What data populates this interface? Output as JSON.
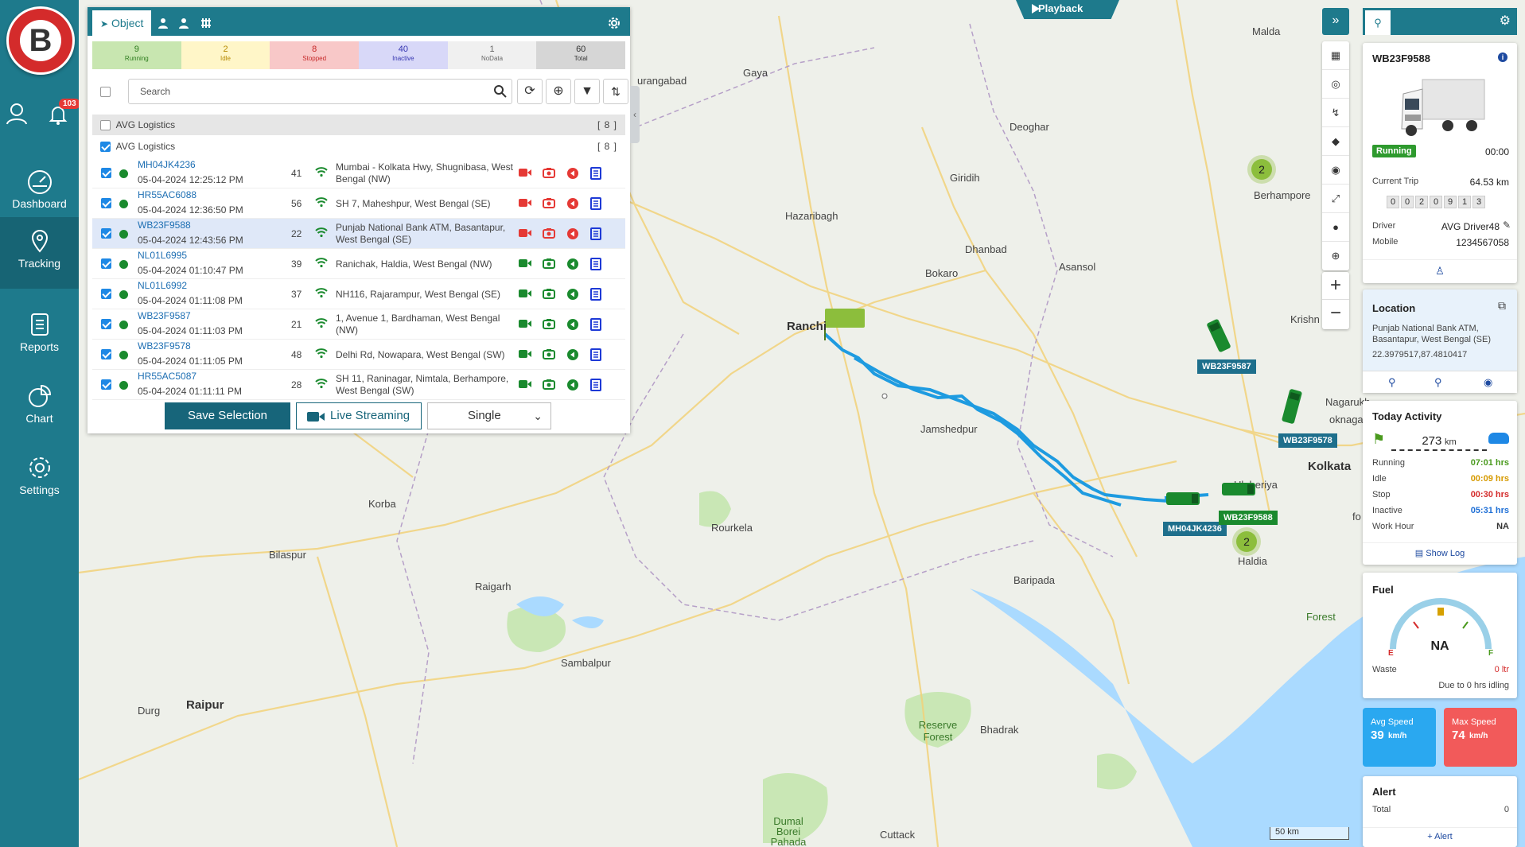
{
  "sidebar": {
    "notification_count": "103",
    "items": [
      {
        "label": "Dashboard"
      },
      {
        "label": "Tracking"
      },
      {
        "label": "Reports"
      },
      {
        "label": "Chart"
      },
      {
        "label": "Settings"
      }
    ]
  },
  "panel": {
    "tab_object": "Object",
    "stats": [
      {
        "value": "9",
        "label": "Running",
        "bg": "#c8e6b0",
        "color": "#2e7d1e"
      },
      {
        "value": "2",
        "label": "Idle",
        "bg": "#fff6c8",
        "color": "#b58900"
      },
      {
        "value": "8",
        "label": "Stopped",
        "bg": "#f8c8c8",
        "color": "#c62828"
      },
      {
        "value": "40",
        "label": "Inactive",
        "bg": "#d8d8f8",
        "color": "#3535b0"
      },
      {
        "value": "1",
        "label": "NoData",
        "bg": "#f0f0f0",
        "color": "#666"
      },
      {
        "value": "60",
        "label": "Total",
        "bg": "#d6d6d6",
        "color": "#333"
      }
    ],
    "search_placeholder": "Search",
    "groups": [
      {
        "name": "AVG Logistics",
        "count": "[ 8 ]"
      },
      {
        "name": "AVG Logistics",
        "count": "[ 8 ]"
      }
    ],
    "rows": [
      {
        "name": "MH04JK4236",
        "time": "05-04-2024 12:25:12 PM",
        "speed": "41",
        "address": "Mumbai - Kolkata Hwy, Shugnibasa, West Bengal (NW)",
        "status": "stopped"
      },
      {
        "name": "HR55AC6088",
        "time": "05-04-2024 12:36:50 PM",
        "speed": "56",
        "address": "SH 7, Maheshpur, West Bengal (SE)",
        "status": "stopped"
      },
      {
        "name": "WB23F9588",
        "time": "05-04-2024 12:43:56 PM",
        "speed": "22",
        "address": "Punjab National Bank ATM, Basantapur, West Bengal (SE)",
        "status": "stopped"
      },
      {
        "name": "NL01L6995",
        "time": "05-04-2024 01:10:47 PM",
        "speed": "39",
        "address": "Ranichak, Haldia, West Bengal (NW)",
        "status": "running"
      },
      {
        "name": "NL01L6992",
        "time": "05-04-2024 01:11:08 PM",
        "speed": "37",
        "address": "NH116, Rajarampur, West Bengal (SE)",
        "status": "running"
      },
      {
        "name": "WB23F9587",
        "time": "05-04-2024 01:11:03 PM",
        "speed": "21",
        "address": "1, Avenue 1, Bardhaman, West Bengal (NW)",
        "status": "running"
      },
      {
        "name": "WB23F9578",
        "time": "05-04-2024 01:11:05 PM",
        "speed": "48",
        "address": "Delhi Rd, Nowapara, West Bengal (SW)",
        "status": "running"
      },
      {
        "name": "HR55AC5087",
        "time": "05-04-2024 01:11:11 PM",
        "speed": "28",
        "address": "SH 11, Raninagar, Nimtala, Berhampore, West Bengal (SW)",
        "status": "running"
      }
    ],
    "save_label": "Save Selection",
    "live_label": "Live Streaming",
    "mode_value": "Single"
  },
  "map": {
    "playback_label": "Playback",
    "scale_label": "50 km",
    "places": [
      {
        "name": "Gaya"
      },
      {
        "name": "urangabad"
      },
      {
        "name": "Malda"
      },
      {
        "name": "Deoghar"
      },
      {
        "name": "Giridih"
      },
      {
        "name": "Hazaribagh"
      },
      {
        "name": "Dhanbad"
      },
      {
        "name": "Asansol"
      },
      {
        "name": "Bokaro"
      },
      {
        "name": "Berhampore"
      },
      {
        "name": "Krishn"
      },
      {
        "name": "Ranchi"
      },
      {
        "name": "Jamshedpur"
      },
      {
        "name": "Nagarukh"
      },
      {
        "name": "oknagar-Ka"
      },
      {
        "name": "Kolkata"
      },
      {
        "name": "Uluberiya"
      },
      {
        "name": "Korba"
      },
      {
        "name": "Rourkela"
      },
      {
        "name": "Bilaspur"
      },
      {
        "name": "Raigarh"
      },
      {
        "name": "Baripada"
      },
      {
        "name": "Haldia"
      },
      {
        "name": "Sambalpur"
      },
      {
        "name": "Raipur"
      },
      {
        "name": "Durg"
      },
      {
        "name": "Reserve Forest"
      },
      {
        "name": "Bhadrak"
      },
      {
        "name": "Dumal Borei Pahada"
      },
      {
        "name": "Cuttack"
      },
      {
        "name": "Forest"
      },
      {
        "name": "fo"
      }
    ],
    "clusters": [
      "2",
      "2"
    ],
    "vehicles": [
      {
        "label": "WB23F9587",
        "color": "#1e6f8c"
      },
      {
        "label": "WB23F9578",
        "color": "#1e6f8c"
      },
      {
        "label": "MH04JK4236",
        "color": "#1e6f8c"
      },
      {
        "label": "WB23F9588",
        "color": "#1a8a2e"
      }
    ]
  },
  "details": {
    "vehicle_name": "WB23F9588",
    "status": "Running",
    "status_time": "00:00",
    "current_trip_label": "Current Trip",
    "current_trip_value": "64.53 km",
    "odometer": [
      "0",
      "0",
      "2",
      "0",
      "9",
      "1",
      "3"
    ],
    "driver_label": "Driver",
    "driver_value": "AVG Driver48",
    "mobile_label": "Mobile",
    "mobile_value": "1234567058",
    "location_title": "Location",
    "location_address": "Punjab National Bank ATM, Basantapur, West Bengal (SE)",
    "location_coords": "22.3979517,87.4810417",
    "activity_title": "Today Activity",
    "activity_distance": "273",
    "activity_unit": "km",
    "activity": [
      {
        "label": "Running",
        "value": "07:01 hrs",
        "color": "#4a9a1e"
      },
      {
        "label": "Idle",
        "value": "00:09 hrs",
        "color": "#d69a00"
      },
      {
        "label": "Stop",
        "value": "00:30 hrs",
        "color": "#d42b2b"
      },
      {
        "label": "Inactive",
        "value": "05:31 hrs",
        "color": "#1e6fd6"
      },
      {
        "label": "Work Hour",
        "value": "NA",
        "color": "#333"
      }
    ],
    "show_log_label": "Show Log",
    "fuel_title": "Fuel",
    "fuel_value": "NA",
    "fuel_e": "E",
    "fuel_f": "F",
    "waste_label": "Waste",
    "waste_value": "0 ltr",
    "idling_note": "Due to 0 hrs idling",
    "avg_speed_label": "Avg Speed",
    "avg_speed_value": "39",
    "max_speed_label": "Max Speed",
    "max_speed_value": "74",
    "speed_unit": "km/h",
    "alert_title": "Alert",
    "alert_total_label": "Total",
    "alert_total_value": "0",
    "add_alert_label": "+ Alert"
  },
  "colors": {
    "sidebar": "#1e7a8c",
    "accent": "#17657a",
    "route": "#1e9be0"
  }
}
